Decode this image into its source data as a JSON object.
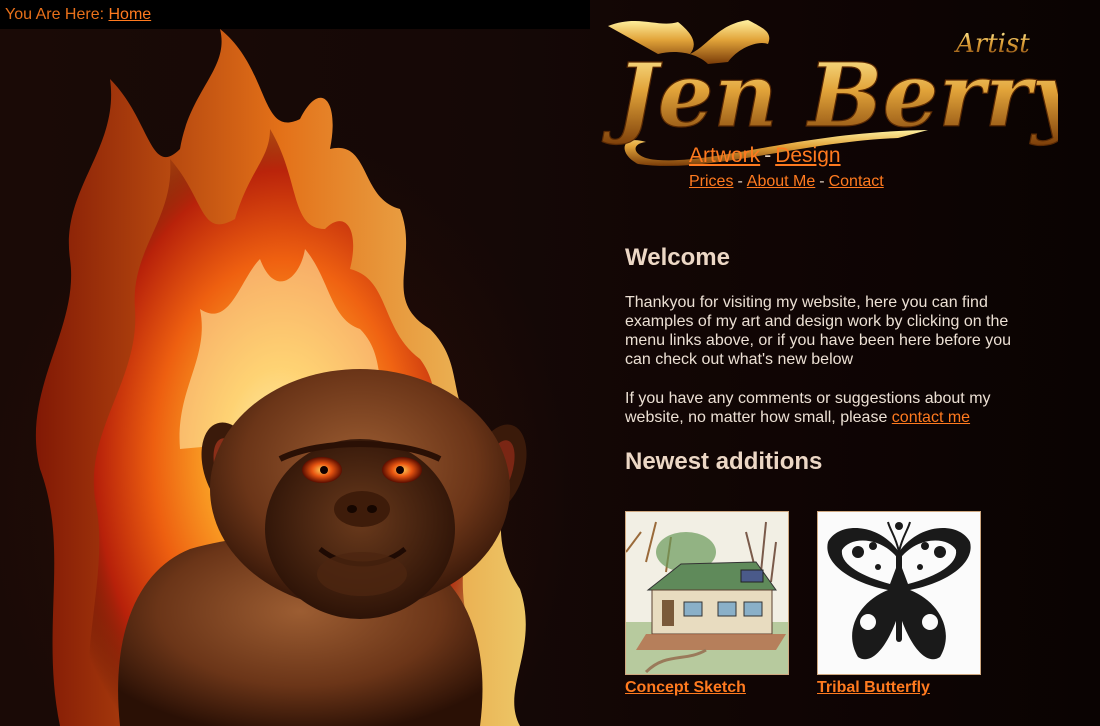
{
  "breadcrumb": {
    "prefix": "You Are Here:",
    "home_link": "Home"
  },
  "logo": {
    "name_text": "Jen Berry",
    "tagline": "Artist"
  },
  "nav": {
    "primary": [
      "Artwork",
      "Design"
    ],
    "secondary": [
      "Prices",
      "About Me",
      "Contact"
    ],
    "separator": "-"
  },
  "welcome": {
    "title": "Welcome",
    "paragraph1": "Thankyou for visiting my website, here you can find examples of my art and design work by clicking on the menu links above, or if you have been here before you can check out what's new below",
    "paragraph2_text": "If you have any comments or suggestions about my website, no matter how small, please",
    "paragraph2_link": "contact me"
  },
  "newest": {
    "title": "Newest additions",
    "items": [
      {
        "label": "Concept Sketch",
        "icon": "house-sketch-thumbnail"
      },
      {
        "label": "Tribal Butterfly",
        "icon": "butterfly-drawing-thumbnail"
      }
    ]
  },
  "colors": {
    "link": "#ff7a1f",
    "background": "#120707",
    "text": "#ece0d4"
  }
}
